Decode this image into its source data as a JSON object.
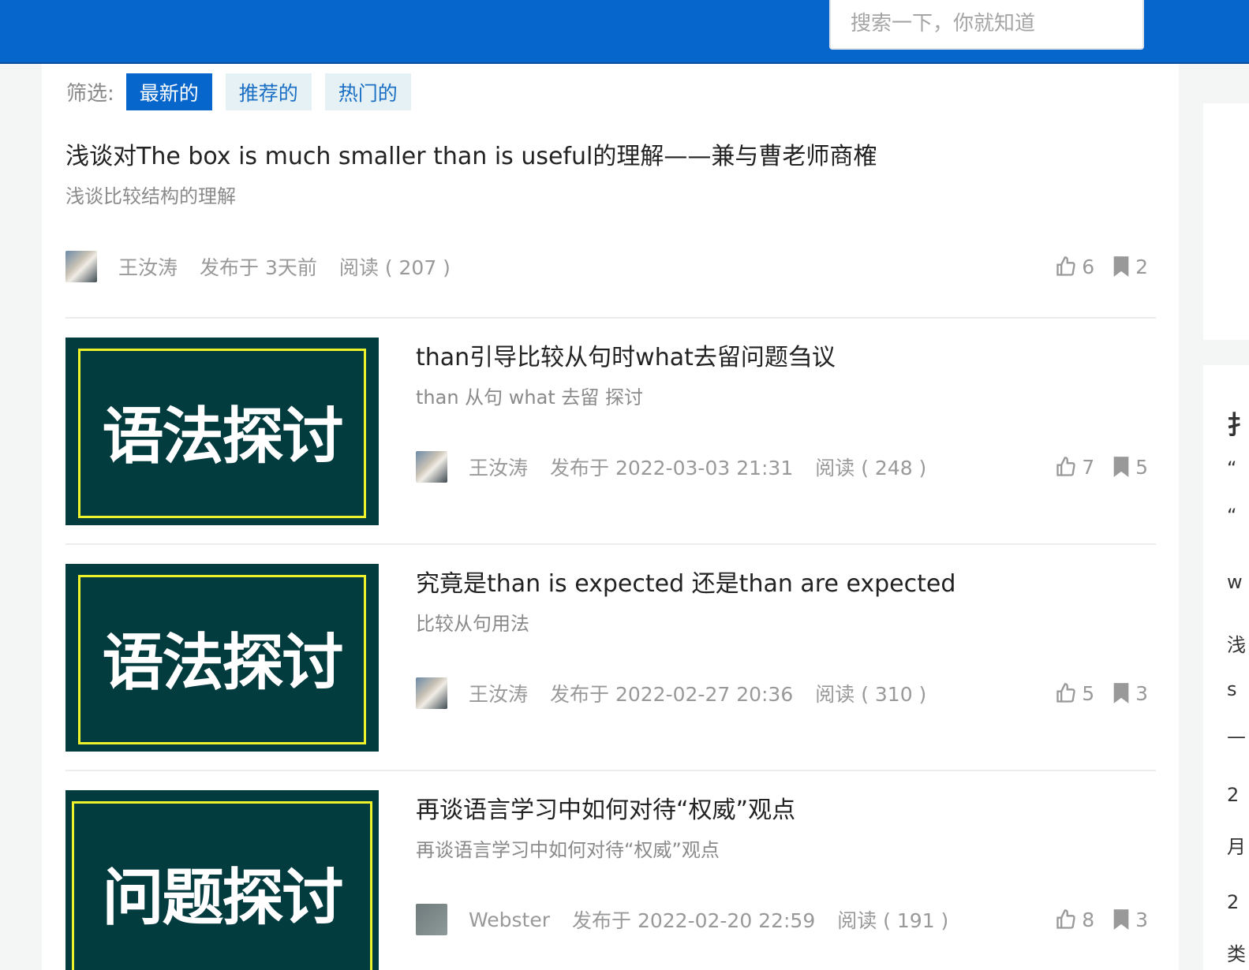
{
  "search": {
    "placeholder": "搜索一下，你就知道"
  },
  "filter": {
    "label": "筛选:",
    "options": [
      "最新的",
      "推荐的",
      "热门的"
    ],
    "active": "最新的"
  },
  "articles": [
    {
      "title": "浅谈对The box is much smaller than is useful的理解——兼与曹老师商榷",
      "summary": "浅谈比较结构的理解",
      "author": "王汝涛",
      "published": "发布于 3天前",
      "reads": "阅读 ( 207 )",
      "likes": "6",
      "bookmarks": "2",
      "has_thumb": false
    },
    {
      "title": "than引导比较从句时what去留问题刍议",
      "summary": "than 从句 what 去留 探讨",
      "author": "王汝涛",
      "published": "发布于 2022-03-03 21:31",
      "reads": "阅读 ( 248 )",
      "likes": "7",
      "bookmarks": "5",
      "thumb_text": "语法探讨"
    },
    {
      "title": "究竟是than is expected 还是than are expected",
      "summary": "比较从句用法",
      "author": "王汝涛",
      "published": "发布于 2022-02-27 20:36",
      "reads": "阅读 ( 310 )",
      "likes": "5",
      "bookmarks": "3",
      "thumb_text": "语法探讨"
    },
    {
      "title": "再谈语言学习中如何对待“权威”观点",
      "summary": "再谈语言学习中如何对待“权威”观点",
      "author": "Webster",
      "published": "发布于 2022-02-20 22:59",
      "reads": "阅读 ( 191 )",
      "likes": "8",
      "bookmarks": "3",
      "thumb_text": "问题探讨"
    }
  ],
  "sidebar_fragments": [
    "扌",
    "“",
    "“",
    "w",
    "浅",
    "s",
    "—",
    "2",
    "月",
    "2",
    "类"
  ],
  "colors": {
    "brand": "#0766cb",
    "thumb_bg": "#033c3f",
    "thumb_frame": "#eef22a"
  }
}
